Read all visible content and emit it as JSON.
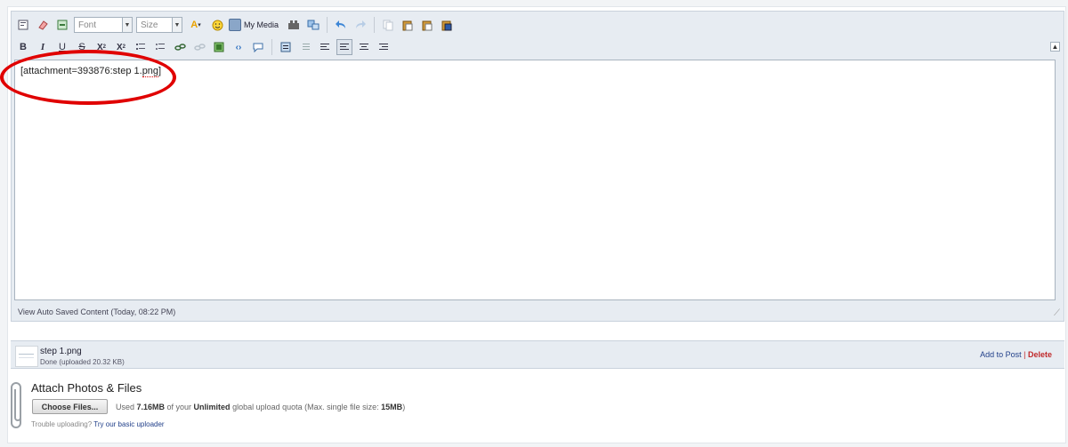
{
  "editor": {
    "font_placeholder": "Font",
    "size_placeholder": "Size",
    "my_media_label": "My Media",
    "text_before": "[attachment=393876:step 1.",
    "text_misspelled": "png",
    "text_after": "]",
    "status_text": "View Auto Saved Content (Today, 08:22 PM)"
  },
  "toolbar": {
    "row1_icons": [
      "source-icon",
      "eraser-icon",
      "spacer-icon",
      "text-color-icon",
      "smiley-icon",
      "media-icon",
      "special-char-icon",
      "code-icon",
      "undo-icon",
      "redo-icon",
      "copy-icon",
      "paste-icon",
      "paste-text-icon",
      "paste-word-icon"
    ],
    "row2_icons": [
      "bold-icon",
      "italic-icon",
      "underline-icon",
      "strikethrough-icon",
      "subscript-icon",
      "superscript-icon",
      "ordered-list-icon",
      "unordered-list-icon",
      "link-icon",
      "unlink-icon",
      "image-icon",
      "code-tag-icon",
      "quote-icon",
      "indent-icon",
      "outdent-icon",
      "align-left-icon",
      "align-center-icon",
      "align-right-icon",
      "justify-icon"
    ]
  },
  "attachment": {
    "file_name": "step 1.png",
    "file_status": "Done (uploaded 20.32 KB)",
    "add_label": "Add to Post",
    "separator": "|",
    "delete_label": "Delete"
  },
  "upload": {
    "title": "Attach Photos & Files",
    "choose_label": "Choose Files...",
    "used_prefix": "Used ",
    "used_amount": "7.16MB",
    "used_mid": " of your ",
    "quota_type": "Unlimited",
    "quota_mid": " global upload quota (Max. single file size: ",
    "max_size": "15MB",
    "quota_end": ")",
    "trouble_text": "Trouble uploading?",
    "basic_uploader_link": "Try our basic uploader"
  },
  "colors": {
    "annotation_circle": "#e00000",
    "delete_link": "#c0282a",
    "link": "#22408a"
  }
}
